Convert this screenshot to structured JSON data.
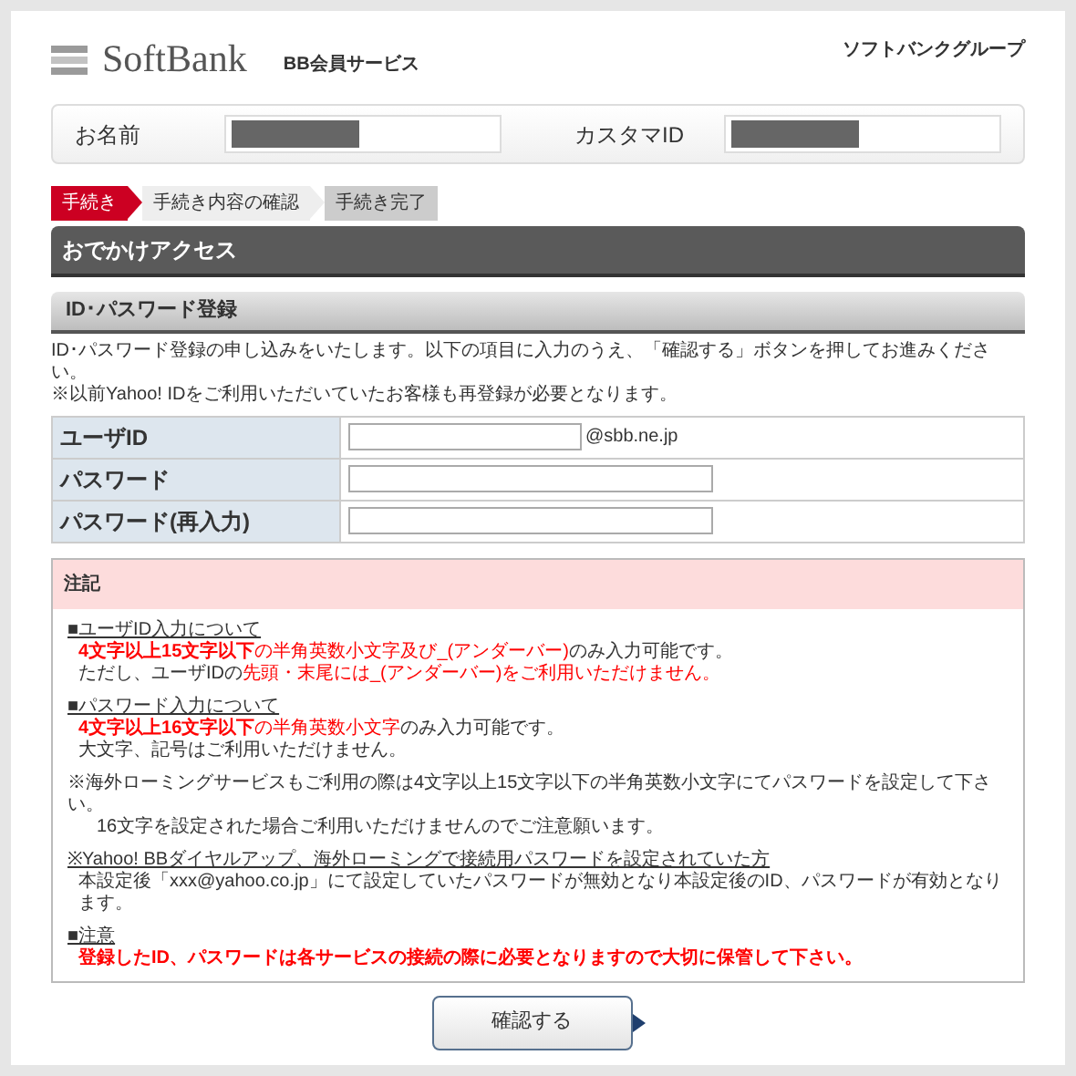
{
  "header": {
    "logo": "SoftBank",
    "service": "BB会員サービス",
    "group": "ソフトバンクグループ"
  },
  "member": [
    {
      "label": "お名前"
    },
    {
      "label": "カスタマID"
    }
  ],
  "steps": [
    {
      "label": "手続き",
      "kind": "current"
    },
    {
      "label": "手続き内容の確認",
      "kind": "next"
    },
    {
      "label": "手続き完了",
      "kind": "final"
    }
  ],
  "page_title": "おでかけアクセス",
  "section_title": "ID･パスワード登録",
  "intro": [
    "ID･パスワード登録の申し込みをいたします。以下の項目に入力のうえ、「確認する」ボタンを押してお進みください。",
    "※以前Yahoo! IDをご利用いただいていたお客様も再登録が必要となります。"
  ],
  "form": [
    {
      "label": "ユーザID",
      "kind": "short",
      "suffix": "@sbb.ne.jp"
    },
    {
      "label": "パスワード",
      "kind": "long"
    },
    {
      "label": "パスワード(再入力)",
      "kind": "long"
    }
  ],
  "notes": {
    "title": "注記",
    "blocks": [
      {
        "heading": "■ユーザID入力について",
        "lines": [
          [
            {
              "text": "4文字以上15文字以下",
              "kind": "strong"
            },
            {
              "text": "の半角英数小文字及び_(アンダーバー)",
              "kind": "red"
            },
            {
              "text": "のみ入力可能です。",
              "kind": "plain"
            }
          ],
          [
            {
              "text": "ただし、ユーザIDの",
              "kind": "plain"
            },
            {
              "text": "先頭・末尾には_(アンダーバー)をご利用いただけません。",
              "kind": "red"
            }
          ]
        ]
      },
      {
        "heading": "■パスワード入力について",
        "lines": [
          [
            {
              "text": "4文字以上16文字以下",
              "kind": "strong"
            },
            {
              "text": "の半角英数小文字",
              "kind": "red"
            },
            {
              "text": "のみ入力可能です。",
              "kind": "plain"
            }
          ],
          [
            {
              "text": "大文字、記号はご利用いただけません。",
              "kind": "plain"
            }
          ]
        ]
      },
      {
        "lines": [
          [
            {
              "text": "※海外ローミングサービスもご利用の際は4文字以上15文字以下の半角英数小文字にてパスワードを設定して下さい。",
              "kind": "plain"
            }
          ],
          [
            {
              "text": "16文字を設定された場合ご利用いただけませんのでご注意願います。",
              "kind": "plain"
            }
          ]
        ]
      },
      {
        "heading": "※Yahoo! BBダイヤルアップ、海外ローミングで接続用パスワードを設定されていた方",
        "lines": [
          [
            {
              "text": "本設定後「xxx@yahoo.co.jp」にて設定していたパスワードが無効となり本設定後のID、パスワードが有効となります。",
              "kind": "plain"
            }
          ]
        ]
      },
      {
        "heading": "■注意",
        "lines": [
          [
            {
              "text": "登録したID、パスワードは各サービスの接続の際に必要となりますので大切に保管して下さい。",
              "kind": "strong"
            }
          ]
        ]
      }
    ]
  },
  "submit": "確認する"
}
